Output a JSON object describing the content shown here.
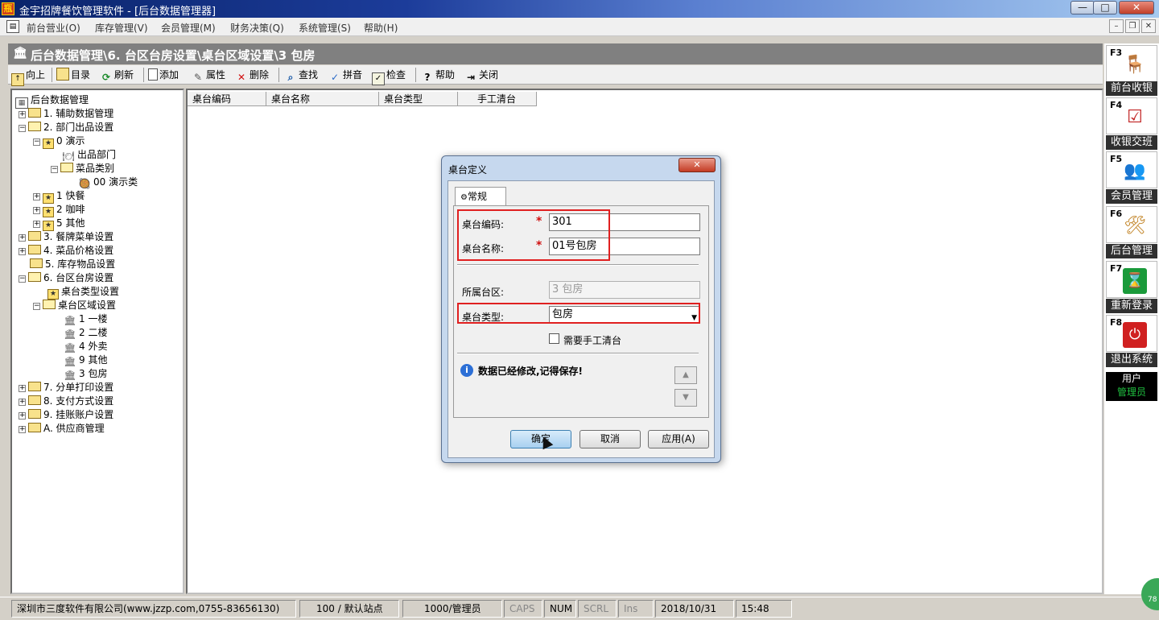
{
  "window": {
    "title": "金宇招牌餐饮管理软件 - [后台数据管理器]",
    "app_icon": "瓶",
    "controls": {
      "minimize": "—",
      "maximize": "□",
      "close": "✕"
    }
  },
  "menubar": {
    "items": [
      "前台营业(O)",
      "库存管理(V)",
      "会员管理(M)",
      "财务决策(Q)",
      "系统管理(S)",
      "帮助(H)"
    ],
    "mdi": {
      "minimize": "–",
      "restore": "❐",
      "close": "✕"
    }
  },
  "breadcrumb": {
    "text": "后台数据管理\\6. 台区台房设置\\桌台区域设置\\3 包房"
  },
  "toolbar": {
    "up": "向上",
    "catalog": "目录",
    "refresh": "刷新",
    "add": "添加",
    "properties": "属性",
    "delete": "删除",
    "find": "查找",
    "pinyin": "拼音",
    "check": "检查",
    "help": "帮助",
    "close": "关闭"
  },
  "tree": {
    "root": "后台数据管理",
    "items": {
      "aux": "1. 辅助数据管理",
      "dept": "2. 部门出品设置",
      "demo": "0 演示",
      "out_dept": "出品部门",
      "dish_cat": "菜品类别",
      "demo_cat": "00 演示类",
      "fast": "1 快餐",
      "coffee": "2 咖啡",
      "other5": "5 其他",
      "menu": "3. 餐牌菜单设置",
      "price": "4. 菜品价格设置",
      "stock": "5. 库存物品设置",
      "area": "6. 台区台房设置",
      "table_type": "桌台类型设置",
      "table_area": "桌台区域设置",
      "floor1": "1 一楼",
      "floor2": "2 二楼",
      "takeout": "4 外卖",
      "other9": "9 其他",
      "room": "3 包房",
      "print": "7. 分单打印设置",
      "payment": "8. 支付方式设置",
      "account": "9. 挂账账户设置",
      "supplier": "A. 供应商管理"
    }
  },
  "table": {
    "columns": [
      "桌台编码",
      "桌台名称",
      "桌台类型",
      "手工清台"
    ]
  },
  "quick_panel": {
    "items": [
      {
        "key": "F3",
        "label": "前台收银"
      },
      {
        "key": "F4",
        "label": "收银交班"
      },
      {
        "key": "F5",
        "label": "会员管理"
      },
      {
        "key": "F6",
        "label": "后台管理"
      },
      {
        "key": "F7",
        "label": "重新登录"
      },
      {
        "key": "F8",
        "label": "退出系统"
      }
    ],
    "user_label": "用户",
    "user_name": "管理员"
  },
  "status": {
    "company": "深圳市三度软件有限公司(www.jzzp.com,0755-83656130)",
    "station": "100 / 默认站点",
    "user": "1000/管理员",
    "caps": "CAPS",
    "num": "NUM",
    "scrl": "SCRL",
    "ins": "Ins",
    "date": "2018/10/31",
    "time": "15:48"
  },
  "dialog": {
    "title": "桌台定义",
    "close": "✕",
    "tab": "常规",
    "code_label": "桌台编码:",
    "code_value": "301",
    "name_label": "桌台名称:",
    "name_value": "01号包房",
    "zone_label": "所属台区:",
    "zone_value": "3 包房",
    "type_label": "桌台类型:",
    "type_value": "包房",
    "manual_clear_label": "需要手工清台",
    "message": "数据已经修改,记得保存!",
    "ok": "确定",
    "cancel": "取消",
    "apply": "应用(A)"
  },
  "corner_badge": "78"
}
